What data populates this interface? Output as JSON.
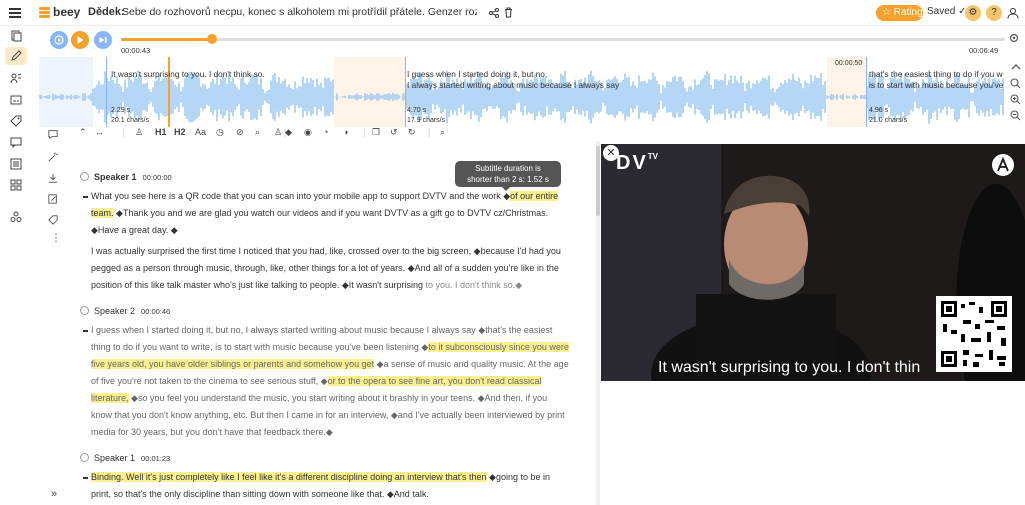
{
  "app": {
    "name": "beey",
    "project_label": "Dědek:",
    "project_title": "Sebe do rozhovorů necpu, konec s alkoholem mi protřídil přátele. Genzer rozesměje i parket",
    "rating_label": "Rating",
    "saved_label": "Saved",
    "accent": "#f5a12a"
  },
  "player": {
    "current_time": "00:00:43",
    "total_time": "00:06:49",
    "progress": 0.103
  },
  "waveform": {
    "cursor_time": "00:00:50",
    "segments": [
      {
        "text": "It wasn't surprising to you. I don't think so.",
        "duration": "2.29 s",
        "rate": "20.1 chars/s"
      },
      {
        "text": "I guess when I started doing it, but no,",
        "text2": "I always started writing about music because I always say",
        "duration": "4.70 s",
        "rate": "17.9 chars/s"
      },
      {
        "text": "that's the easiest thing to do if you w",
        "text2": "is to start with music because you've",
        "duration": "4.96 s",
        "rate": "21.0 chars/s"
      }
    ]
  },
  "toolbar": {
    "h1": "H1",
    "h2": "H2",
    "aa": "Aa"
  },
  "tooltip": {
    "line1": "Subtitle duration is",
    "line2": "shorter than 2 s: 1.52 s"
  },
  "transcript": [
    {
      "speaker": "Speaker 1",
      "time": "00:00:00",
      "p1_a": "What you see here is a QR code that you can scan into your mobile app to support DVTV and the work ◆",
      "p1_hl": "of our entire team.",
      "p1_b": " ◆Thank you and we are glad you watch our videos and if you want DVTV as a gift go to DVTV cz/Christmas. ◆Have a great day. ◆",
      "p2_a": "I was actually surprised the first time I noticed that you had, like, crossed over to the big screen, ◆because I'd had you pegged as a person through music, through, like, other things for a lot of years. ◆And all of a sudden you're like in the position of this like talk master who's just like talking to people. ◆It wasn't surprising",
      "p2_grey": " to you. I don't think so.◆"
    },
    {
      "speaker": "Speaker 2",
      "time": "00:00:46",
      "p1_a": "I guess when I started doing it, but no, I always started writing about music because I always say ◆that's the easiest thing to do if you want to write, is to start with music because you've been listening ◆",
      "p1_hl1": "to it subconsciously since you were five years old, you have older siblings or parents and somehow you get",
      "p1_b": " ◆a sense of music and quality music. At the age of five you're not taken to the cinema to see serious stuff, ◆",
      "p1_hl2": "or to the opera to see fine art, you don't read classical literature,",
      "p1_c": " ◆so you feel you understand the music, you start writing about it brashly in your teens. ◆And then, if you know that you don't know anything, etc. But then I came in for an interview, ◆and I've actually been interviewed by print media for 30 years, but you don't have that feedback there.◆"
    },
    {
      "speaker": "Speaker 1",
      "time": "00:01:23",
      "p1_hl": "Binding. Well it's just completely like I feel like it's a different discipline doing an interview that's then",
      "p1_b": " ◆going to be in print, so that's the only discipline than sitting down with someone like that. ◆And talk."
    }
  ],
  "video": {
    "logo": "DV",
    "logo_sup": "TV",
    "subtitle": "It wasn't surprising to you. I don't thin"
  }
}
